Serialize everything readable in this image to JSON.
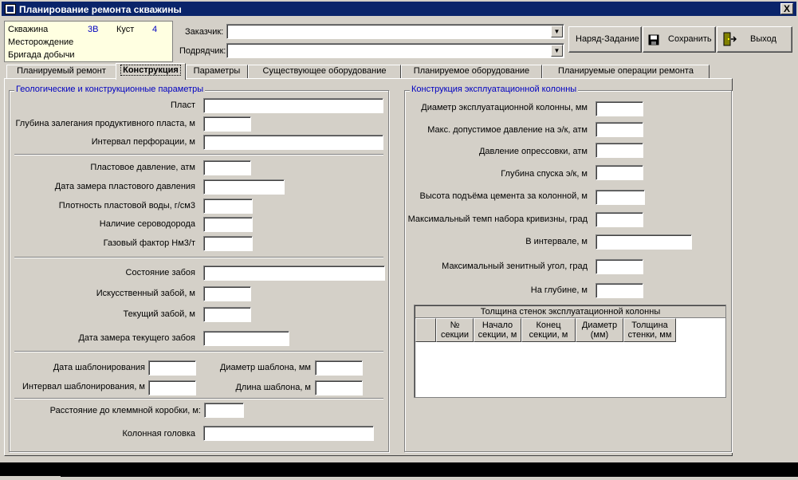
{
  "window": {
    "title": "Планирование ремонта скважины",
    "close_label": "X"
  },
  "info": {
    "well_label": "Скважина",
    "well_value": "3В",
    "pad_label": "Куст",
    "pad_value": "4",
    "field_label": "Месторождение",
    "brigade_label": "Бригада добычи"
  },
  "header": {
    "customer_label": "Заказчик:",
    "customer_value": "",
    "contractor_label": "Подрядчик:",
    "contractor_value": ""
  },
  "toolbar": {
    "order_label": "Наряд-Задание",
    "save_label": "Сохранить",
    "exit_label": "Выход"
  },
  "tabs": [
    {
      "label": "Планируемый ремонт"
    },
    {
      "label": "Конструкция"
    },
    {
      "label": "Параметры"
    },
    {
      "label": "Существующее оборудование"
    },
    {
      "label": "Планируемое оборудование"
    },
    {
      "label": "Планируемые операции ремонта"
    }
  ],
  "active_tab": "Конструкция",
  "geo": {
    "title": "Геологические и конструкционные параметры",
    "formation": "Пласт",
    "depth": "Глубина залегания продуктивного пласта, м",
    "perforation": "Интервал перфорации, м",
    "pressure": "Пластовое давление, атм",
    "pressure_date": "Дата замера пластового давления",
    "water_density": "Плотность пластовой воды, г/см3",
    "h2s": "Наличие сероводорода",
    "gas_factor": "Газовый фактор Нм3/т",
    "bottom_state": "Состояние забоя",
    "artificial_bottom": "Искусственный забой, м",
    "current_bottom": "Текущий забой, м",
    "bottom_date": "Дата замера текущего забоя",
    "template_date": "Дата шаблонирования",
    "template_diameter": "Диаметр шаблона, мм",
    "template_interval": "Интервал шаблонирования, м",
    "template_length": "Длина шаблона, м",
    "terminal_distance": "Расстояние до клеммной коробки, м:",
    "casing_head": "Колонная головка"
  },
  "casing": {
    "title": "Конструкция  эксплуатационной колонны",
    "diameter": "Диаметр эксплуатационной колонны, мм",
    "max_pressure": "Макс. допустимое давление на э/к, атм",
    "test_pressure": "Давление опрессовки, атм",
    "run_depth": "Глубина спуска э/к, м",
    "cement_height": "Высота подъёма цемента за колонной, м",
    "max_dogleg": "Максимальный темп набора кривизны, град",
    "in_interval": "В интервале, м",
    "max_zenith": "Максимальный зенитный угол, град",
    "at_depth": "На глубине, м"
  },
  "wall_table": {
    "title": "Толщина стенок эксплуатационной колонны",
    "columns": [
      {
        "l1": "№",
        "l2": "секции"
      },
      {
        "l1": "Начало",
        "l2": "секции, м"
      },
      {
        "l1": "Конец",
        "l2": "секции, м"
      },
      {
        "l1": "Диаметр",
        "l2": "(мм)"
      },
      {
        "l1": "Толщина",
        "l2": "стенки, мм"
      }
    ],
    "rows": []
  }
}
